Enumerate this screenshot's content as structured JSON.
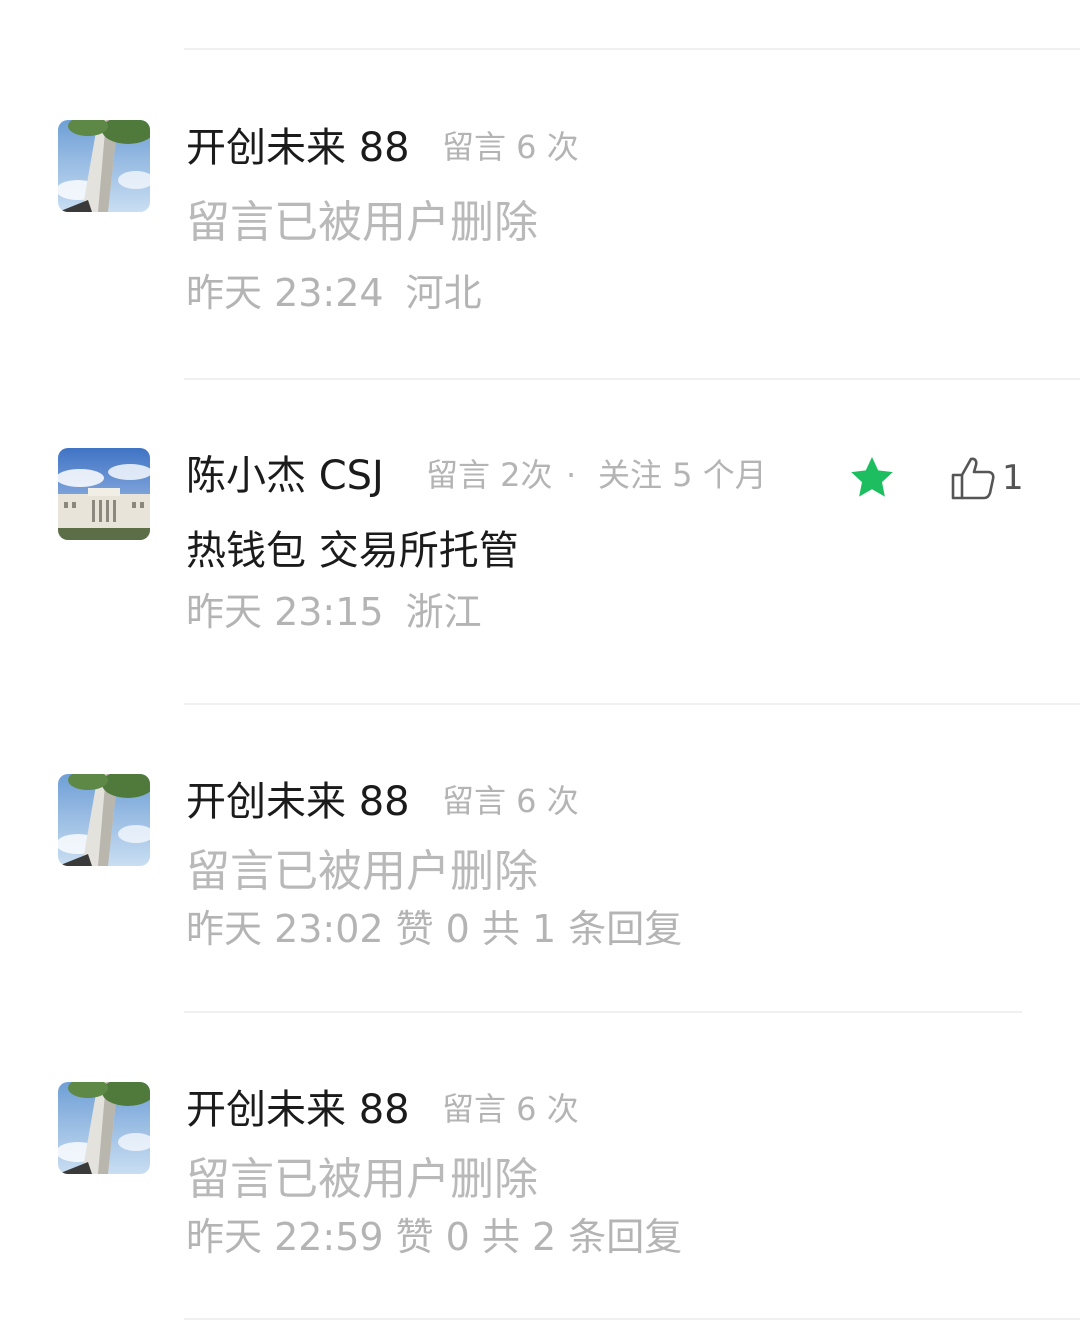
{
  "colors": {
    "accent_green": "#1dbe5f",
    "name_text": "#1b1b1b",
    "muted_text": "#b4b4b4"
  },
  "comments": [
    {
      "name": "开创未来 88",
      "stats": "留言 6 次",
      "content": "留言已被用户删除",
      "time": "昨天 23:24",
      "location": "河北",
      "avatar_icon": "tree-photo-avatar"
    },
    {
      "name": "陈小杰 CSJ",
      "stats": "留言 2次",
      "dot": "·",
      "follow": "关注 5 个月",
      "content": "热钱包 交易所托管",
      "time": "昨天 23:15",
      "location": "浙江",
      "starred_icon": "star-icon",
      "like_icon": "thumbs-up-icon",
      "like_count": "1",
      "avatar_icon": "building-photo-avatar"
    },
    {
      "name": "开创未来 88",
      "stats": "留言 6 次",
      "content": "留言已被用户删除",
      "time": "昨天 23:02",
      "likes": "赞 0",
      "replies": "共 1 条回复",
      "avatar_icon": "tree-photo-avatar"
    },
    {
      "name": "开创未来 88",
      "stats": "留言 6 次",
      "content": "留言已被用户删除",
      "time": "昨天 22:59",
      "likes": "赞 0",
      "replies": "共 2 条回复",
      "avatar_icon": "tree-photo-avatar"
    }
  ]
}
